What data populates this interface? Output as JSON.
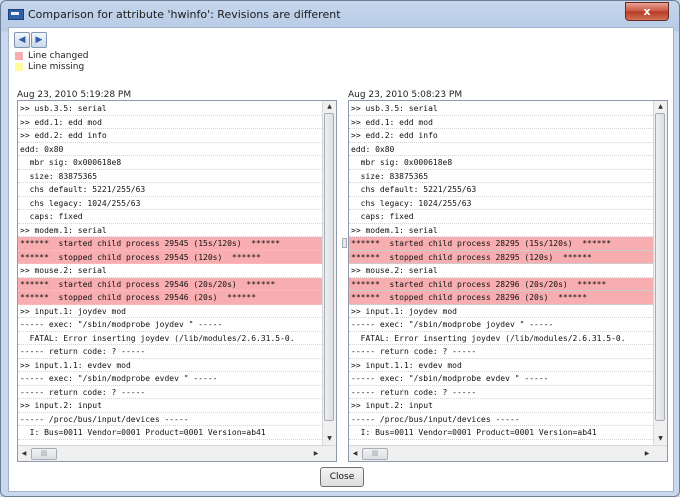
{
  "window": {
    "title": "Comparison for attribute 'hwinfo': Revisions are different",
    "close_label": "x"
  },
  "toolbar": {
    "buttons": [
      {
        "icon": "diff-prev-icon"
      },
      {
        "icon": "diff-next-icon"
      }
    ]
  },
  "legend": [
    {
      "label": "Line changed",
      "color": "#f8aeb0"
    },
    {
      "label": "Line missing",
      "color": "#fffaa0"
    }
  ],
  "left_panel": {
    "date": "Aug 23, 2010 5:19:28 PM",
    "lines": [
      {
        "text": ">> usb.3.5: serial",
        "state": "normal"
      },
      {
        "text": ">> edd.1: edd mod",
        "state": "normal"
      },
      {
        "text": ">> edd.2: edd info",
        "state": "normal"
      },
      {
        "text": "edd: 0x80",
        "state": "normal"
      },
      {
        "text": "  mbr sig: 0x000618e8",
        "state": "normal"
      },
      {
        "text": "  size: 83875365",
        "state": "normal"
      },
      {
        "text": "  chs default: 5221/255/63",
        "state": "normal"
      },
      {
        "text": "  chs legacy: 1024/255/63",
        "state": "normal"
      },
      {
        "text": "  caps: fixed",
        "state": "normal"
      },
      {
        "text": ">> modem.1: serial",
        "state": "normal"
      },
      {
        "text": "******  started child process 29545 (15s/120s)  ******",
        "state": "changed"
      },
      {
        "text": "******  stopped child process 29545 (120s)  ******",
        "state": "changed"
      },
      {
        "text": ">> mouse.2: serial",
        "state": "normal"
      },
      {
        "text": "******  started child process 29546 (20s/20s)  ******",
        "state": "changed"
      },
      {
        "text": "******  stopped child process 29546 (20s)  ******",
        "state": "changed"
      },
      {
        "text": ">> input.1: joydev mod",
        "state": "normal"
      },
      {
        "text": "----- exec: \"/sbin/modprobe joydev \" -----",
        "state": "normal"
      },
      {
        "text": "  FATAL: Error inserting joydev (/lib/modules/2.6.31.5-0.",
        "state": "normal"
      },
      {
        "text": "----- return code: ? -----",
        "state": "normal"
      },
      {
        "text": ">> input.1.1: evdev mod",
        "state": "normal"
      },
      {
        "text": "----- exec: \"/sbin/modprobe evdev \" -----",
        "state": "normal"
      },
      {
        "text": "----- return code: ? -----",
        "state": "normal"
      },
      {
        "text": ">> input.2: input",
        "state": "normal"
      },
      {
        "text": "----- /proc/bus/input/devices -----",
        "state": "normal"
      },
      {
        "text": "  I: Bus=0011 Vendor=0001 Product=0001 Version=ab41",
        "state": "normal"
      }
    ]
  },
  "right_panel": {
    "date": "Aug 23, 2010 5:08:23 PM",
    "lines": [
      {
        "text": ">> usb.3.5: serial",
        "state": "normal"
      },
      {
        "text": ">> edd.1: edd mod",
        "state": "normal"
      },
      {
        "text": ">> edd.2: edd info",
        "state": "normal"
      },
      {
        "text": "edd: 0x80",
        "state": "normal"
      },
      {
        "text": "  mbr sig: 0x000618e8",
        "state": "normal"
      },
      {
        "text": "  size: 83875365",
        "state": "normal"
      },
      {
        "text": "  chs default: 5221/255/63",
        "state": "normal"
      },
      {
        "text": "  chs legacy: 1024/255/63",
        "state": "normal"
      },
      {
        "text": "  caps: fixed",
        "state": "normal"
      },
      {
        "text": ">> modem.1: serial",
        "state": "normal"
      },
      {
        "text": "******  started child process 28295 (15s/120s)  ******",
        "state": "changed"
      },
      {
        "text": "******  stopped child process 28295 (120s)  ******",
        "state": "changed"
      },
      {
        "text": ">> mouse.2: serial",
        "state": "normal"
      },
      {
        "text": "******  started child process 28296 (20s/20s)  ******",
        "state": "changed"
      },
      {
        "text": "******  stopped child process 28296 (20s)  ******",
        "state": "changed"
      },
      {
        "text": ">> input.1: joydev mod",
        "state": "normal"
      },
      {
        "text": "----- exec: \"/sbin/modprobe joydev \" -----",
        "state": "normal"
      },
      {
        "text": "  FATAL: Error inserting joydev (/lib/modules/2.6.31.5-0.",
        "state": "normal"
      },
      {
        "text": "----- return code: ? -----",
        "state": "normal"
      },
      {
        "text": ">> input.1.1: evdev mod",
        "state": "normal"
      },
      {
        "text": "----- exec: \"/sbin/modprobe evdev \" -----",
        "state": "normal"
      },
      {
        "text": "----- return code: ? -----",
        "state": "normal"
      },
      {
        "text": ">> input.2: input",
        "state": "normal"
      },
      {
        "text": "----- /proc/bus/input/devices -----",
        "state": "normal"
      },
      {
        "text": "  I: Bus=0011 Vendor=0001 Product=0001 Version=ab41",
        "state": "normal"
      }
    ]
  },
  "footer": {
    "close_label": "Close"
  }
}
